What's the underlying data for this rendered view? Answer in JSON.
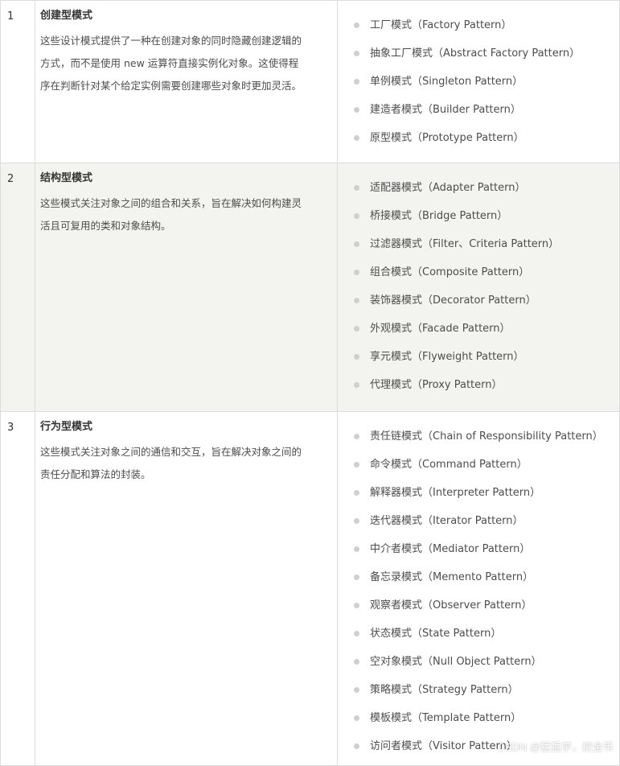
{
  "rows": [
    {
      "num": "1",
      "title": "创建型模式",
      "desc_lines": [
        "这些设计模式提供了一种在创建对象的同时隐藏创建逻辑的",
        "方式，而不是使用 new 运算符直接实例化对象。这使得程",
        "序在判断针对某个给定实例需要创建哪些对象时更加灵活。"
      ],
      "patterns": [
        "工厂模式（Factory Pattern）",
        "抽象工厂模式（Abstract Factory Pattern）",
        "单例模式（Singleton Pattern）",
        "建造者模式（Builder Pattern）",
        "原型模式（Prototype Pattern）"
      ]
    },
    {
      "num": "2",
      "title": "结构型模式",
      "desc_lines": [
        "这些模式关注对象之间的组合和关系，旨在解决如何构建灵",
        "活且可复用的类和对象结构。"
      ],
      "patterns": [
        "适配器模式（Adapter Pattern）",
        "桥接模式（Bridge Pattern）",
        "过滤器模式（Filter、Criteria Pattern）",
        "组合模式（Composite Pattern）",
        "装饰器模式（Decorator Pattern）",
        "外观模式（Facade Pattern）",
        "享元模式（Flyweight Pattern）",
        "代理模式（Proxy Pattern）"
      ]
    },
    {
      "num": "3",
      "title": "行为型模式",
      "desc_lines": [
        "这些模式关注对象之间的通信和交互，旨在解决对象之间的",
        "责任分配和算法的封装。"
      ],
      "patterns": [
        "责任链模式（Chain of Responsibility Pattern）",
        "命令模式（Command Pattern）",
        "解释器模式（Interpreter Pattern）",
        "迭代器模式（Iterator Pattern）",
        "中介者模式（Mediator Pattern）",
        "备忘录模式（Memento Pattern）",
        "观察者模式（Observer Pattern）",
        "状态模式（State Pattern）",
        "空对象模式（Null Object Pattern）",
        "策略模式（Strategy Pattern）",
        "模板模式（Template Pattern）",
        "访问者模式（Visitor Pattern）"
      ]
    }
  ],
  "watermark": "CSDN @猛猛学，挖金币"
}
